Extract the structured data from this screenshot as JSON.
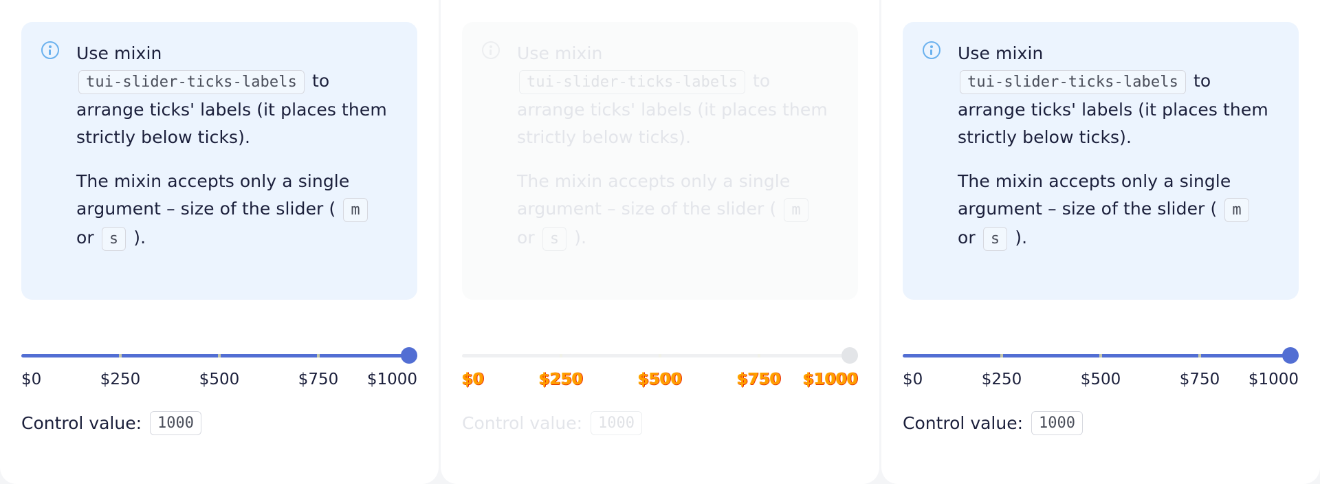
{
  "panels": [
    {
      "state": "enabled",
      "notification": {
        "intro": "Use mixin",
        "mixin_code": "tui-slider-ticks-labels",
        "after_code": "to arrange ticks' labels (it places them strictly below ticks).",
        "para2_start": "The mixin accepts only a single argument – size of the slider (",
        "size_m": "m",
        "or_text": "or",
        "size_s": "s",
        "para2_end": ")."
      },
      "slider": {
        "value": 1000,
        "min": 0,
        "max": 1000,
        "ticks": [
          "$0",
          "$250",
          "$500",
          "$750",
          "$1000"
        ]
      },
      "control": {
        "label": "Control value:",
        "value": "1000"
      }
    },
    {
      "state": "disabled",
      "notification": {
        "intro": "Use mixin",
        "mixin_code": "tui-slider-ticks-labels",
        "after_code": "to arrange ticks' labels (it places them strictly below ticks).",
        "para2_start": "The mixin accepts only a single argument – size of the slider (",
        "size_m": "m",
        "or_text": "or",
        "size_s": "s",
        "para2_end": ")."
      },
      "slider": {
        "value": 1000,
        "min": 0,
        "max": 1000,
        "ticks": [
          "$0",
          "$250",
          "$500",
          "$750",
          "$1000"
        ]
      },
      "control": {
        "label": "Control value:",
        "value": "1000"
      }
    },
    {
      "state": "enabled",
      "notification": {
        "intro": "Use mixin",
        "mixin_code": "tui-slider-ticks-labels",
        "after_code": "to arrange ticks' labels (it places them strictly below ticks).",
        "para2_start": "The mixin accepts only a single argument – size of the slider (",
        "size_m": "m",
        "or_text": "or",
        "size_s": "s",
        "para2_end": ")."
      },
      "slider": {
        "value": 1000,
        "min": 0,
        "max": 1000,
        "ticks": [
          "$0",
          "$250",
          "$500",
          "$750",
          "$1000"
        ]
      },
      "control": {
        "label": "Control value:",
        "value": "1000"
      }
    }
  ],
  "colors": {
    "accent": "#526ed3",
    "info": "#6ab1ee",
    "notification_bg": "#ecf4fe"
  }
}
